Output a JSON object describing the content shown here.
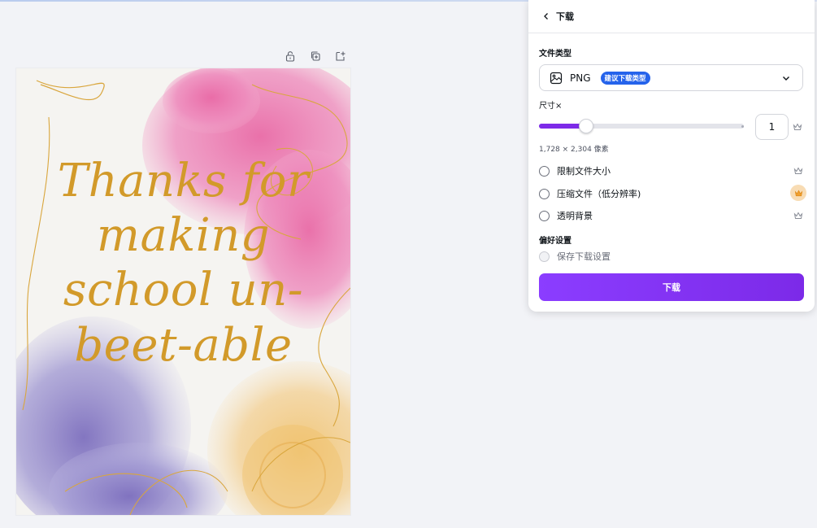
{
  "panel": {
    "title": "下载",
    "file_type_label": "文件类型",
    "file_type_value": "PNG",
    "file_type_badge": "建议下载类型",
    "size_label": "尺寸×",
    "size_value": "1",
    "size_slider_fraction": 0.21,
    "dimensions_text": "1,728 × 2,304 像素",
    "options": [
      {
        "label": "限制文件大小",
        "checked": false,
        "premium": true
      },
      {
        "label": "压缩文件（低分辨率)",
        "checked": false,
        "premium": true,
        "highlighted": true
      },
      {
        "label": "透明背景",
        "checked": false,
        "premium": true
      }
    ],
    "preferences_label": "偏好设置",
    "save_settings_label": "保存下载设置",
    "download_button": "下载"
  },
  "card": {
    "lines": [
      "Thanks for",
      "making",
      "school un-",
      "beet-able"
    ]
  },
  "colors": {
    "accent": "#7d2ae8",
    "badge": "#2563eb",
    "gold": "#d29a2a"
  },
  "icons": {
    "toolbar": [
      "lock-icon",
      "duplicate-icon",
      "add-page-icon"
    ],
    "back": "chevron-left-icon",
    "file": "image-icon",
    "dropdown": "chevron-down-icon",
    "premium": "crown-icon"
  }
}
